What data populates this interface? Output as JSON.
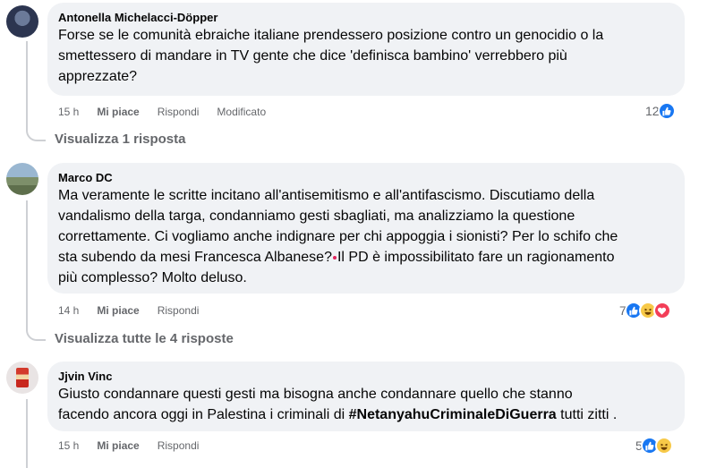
{
  "comments": [
    {
      "author": "Antonella Michelacci-Döpper",
      "text": "Forse se le comunità ebraiche italiane prendessero posizione contro un genocidio o la\nsmettessero di mandare in TV gente che dice 'definisca bambino' verrebbero più\napprezzate?",
      "time": "15 h",
      "like_label": "Mi piace",
      "reply_label": "Rispondi",
      "edited_label": "Modificato",
      "reaction_count": "12",
      "reactions": [
        "like-icon"
      ],
      "view_replies": "Visualizza 1 risposta"
    },
    {
      "author": "Marco DC",
      "text_before": "Ma veramente le scritte incitano all'antisemitismo e all'antifascismo. Discutiamo della\nvandalismo della targa, condanniamo gesti sbagliati, ma analizziamo la questione\ncorrettamente. Ci vogliamo anche indignare per chi appoggia i sionisti? Per lo schifo che\nsta subendo da mesi Francesca Albanese?",
      "text_after": "Il PD è impossibilitato fare un ragionamento\npiù complesso? Molto deluso.",
      "time": "14 h",
      "like_label": "Mi piace",
      "reply_label": "Rispondi",
      "reaction_count": "7",
      "reactions": [
        "like-icon",
        "haha-icon",
        "love-icon"
      ],
      "view_replies": "Visualizza tutte le 4 risposte"
    },
    {
      "author": "Jjvin Vinc",
      "text_before": "Giusto condannare questi gesti ma bisogna anche condannare quello che stanno\nfacendo ancora oggi in Palestina i criminali di ",
      "hashtag": "#NetanyahuCriminaleDiGuerra",
      "text_after": " tutti zitti .",
      "time": "15 h",
      "like_label": "Mi piace",
      "reply_label": "Rispondi",
      "reaction_count": "5",
      "reactions": [
        "like-icon",
        "haha-icon"
      ]
    }
  ],
  "colors": {
    "like": "#1877f2",
    "haha": "#f7c948",
    "love": "#f33e58",
    "bubble": "#f0f2f5",
    "meta": "#65676b"
  }
}
